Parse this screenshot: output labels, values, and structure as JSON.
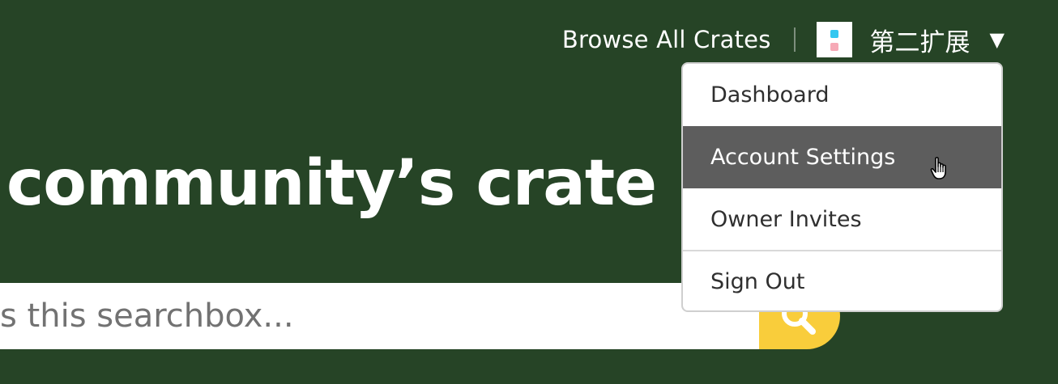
{
  "nav": {
    "browse_label": "Browse All Crates",
    "username": "第二扩展",
    "caret": "▼",
    "avatar_colors": [
      "#33c7f0",
      "#f6a9b6"
    ]
  },
  "hero": {
    "text": "community’s crate registry"
  },
  "search": {
    "placeholder": "s this searchbox...",
    "button_icon": "search-icon",
    "accent_color": "#f9cd3b"
  },
  "dropdown": {
    "items": [
      {
        "label": "Dashboard"
      },
      {
        "label": "Account Settings",
        "state": "hovered"
      },
      {
        "label": "Owner Invites"
      },
      {
        "label": "Sign Out"
      }
    ]
  },
  "colors": {
    "background": "#264426",
    "hover": "#5d5d5d"
  }
}
